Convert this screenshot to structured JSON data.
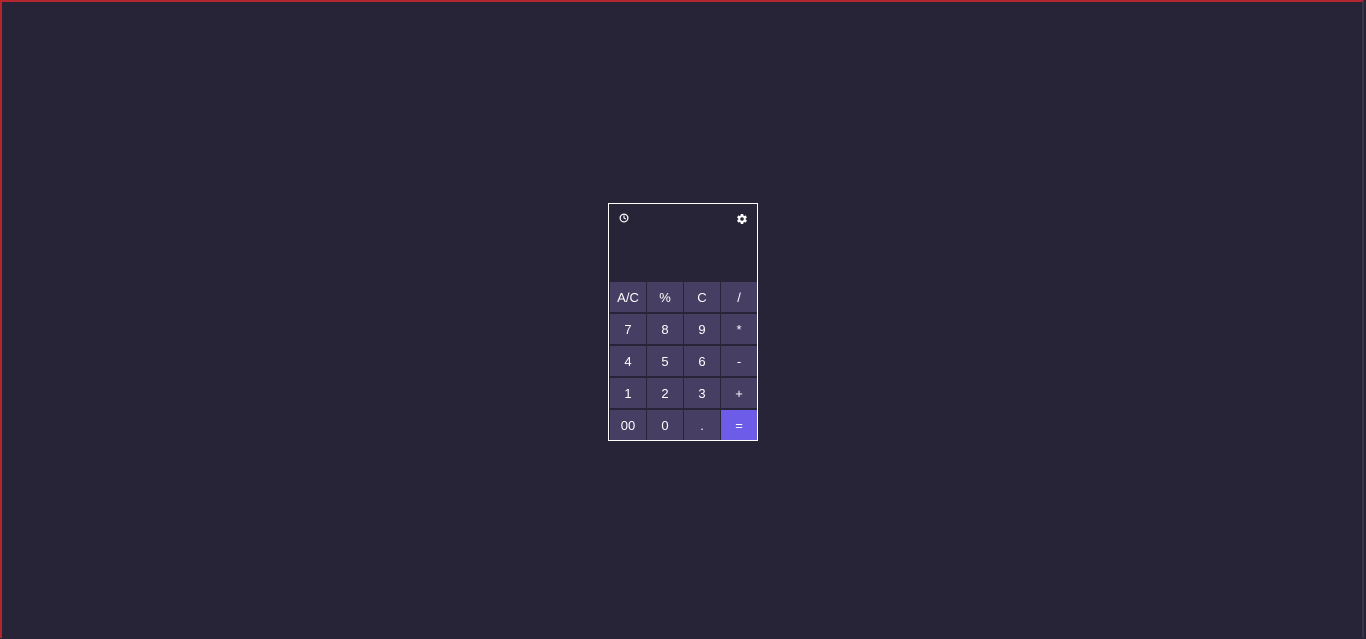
{
  "colors": {
    "background": "#272438",
    "key": "#463f63",
    "accent": "#6c5ce7",
    "border": "#ffffff"
  },
  "calculator": {
    "history_icon": "clock-icon",
    "settings_icon": "gear-icon",
    "display_value": "",
    "keys": [
      "A/C",
      "%",
      "C",
      "/",
      "7",
      "8",
      "9",
      "*",
      "4",
      "5",
      "6",
      "-",
      "1",
      "2",
      "3",
      "+",
      "00",
      "0",
      ".",
      "="
    ]
  }
}
